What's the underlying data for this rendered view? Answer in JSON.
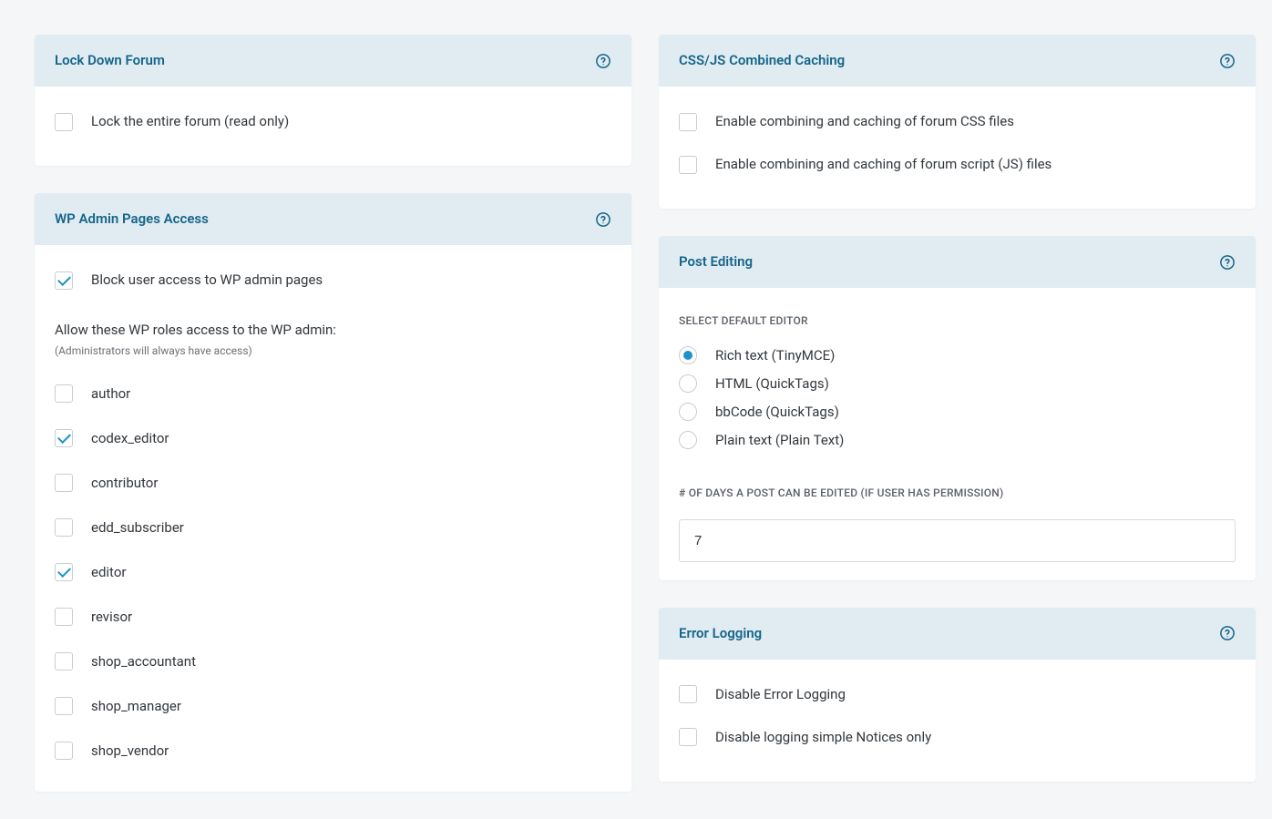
{
  "left": {
    "lock_down": {
      "title": "Lock Down Forum",
      "option_label": "Lock the entire forum (read only)",
      "option_checked": false
    },
    "wp_admin": {
      "title": "WP Admin Pages Access",
      "block_label": "Block user access to WP admin pages",
      "block_checked": true,
      "roles_intro": "Allow these WP roles access to the WP admin:",
      "roles_note": "(Administrators will always have access)",
      "roles": [
        {
          "label": "author",
          "checked": false
        },
        {
          "label": "codex_editor",
          "checked": true
        },
        {
          "label": "contributor",
          "checked": false
        },
        {
          "label": "edd_subscriber",
          "checked": false
        },
        {
          "label": "editor",
          "checked": true
        },
        {
          "label": "revisor",
          "checked": false
        },
        {
          "label": "shop_accountant",
          "checked": false
        },
        {
          "label": "shop_manager",
          "checked": false
        },
        {
          "label": "shop_vendor",
          "checked": false
        }
      ]
    }
  },
  "right": {
    "caching": {
      "title": "CSS/JS Combined Caching",
      "css_label": "Enable combining and caching of forum CSS files",
      "css_checked": false,
      "js_label": "Enable combining and caching of forum script (JS) files",
      "js_checked": false
    },
    "post_editing": {
      "title": "Post Editing",
      "editor_section_label": "SELECT DEFAULT EDITOR",
      "editors": [
        {
          "label": "Rich text (TinyMCE)",
          "checked": true
        },
        {
          "label": "HTML (QuickTags)",
          "checked": false
        },
        {
          "label": "bbCode (QuickTags)",
          "checked": false
        },
        {
          "label": "Plain text (Plain Text)",
          "checked": false
        }
      ],
      "days_section_label": "# OF DAYS A POST CAN BE EDITED (IF USER HAS PERMISSION)",
      "days_value": "7"
    },
    "error_logging": {
      "title": "Error Logging",
      "disable_label": "Disable Error Logging",
      "disable_checked": false,
      "notices_label": "Disable logging simple Notices only",
      "notices_checked": false
    }
  }
}
